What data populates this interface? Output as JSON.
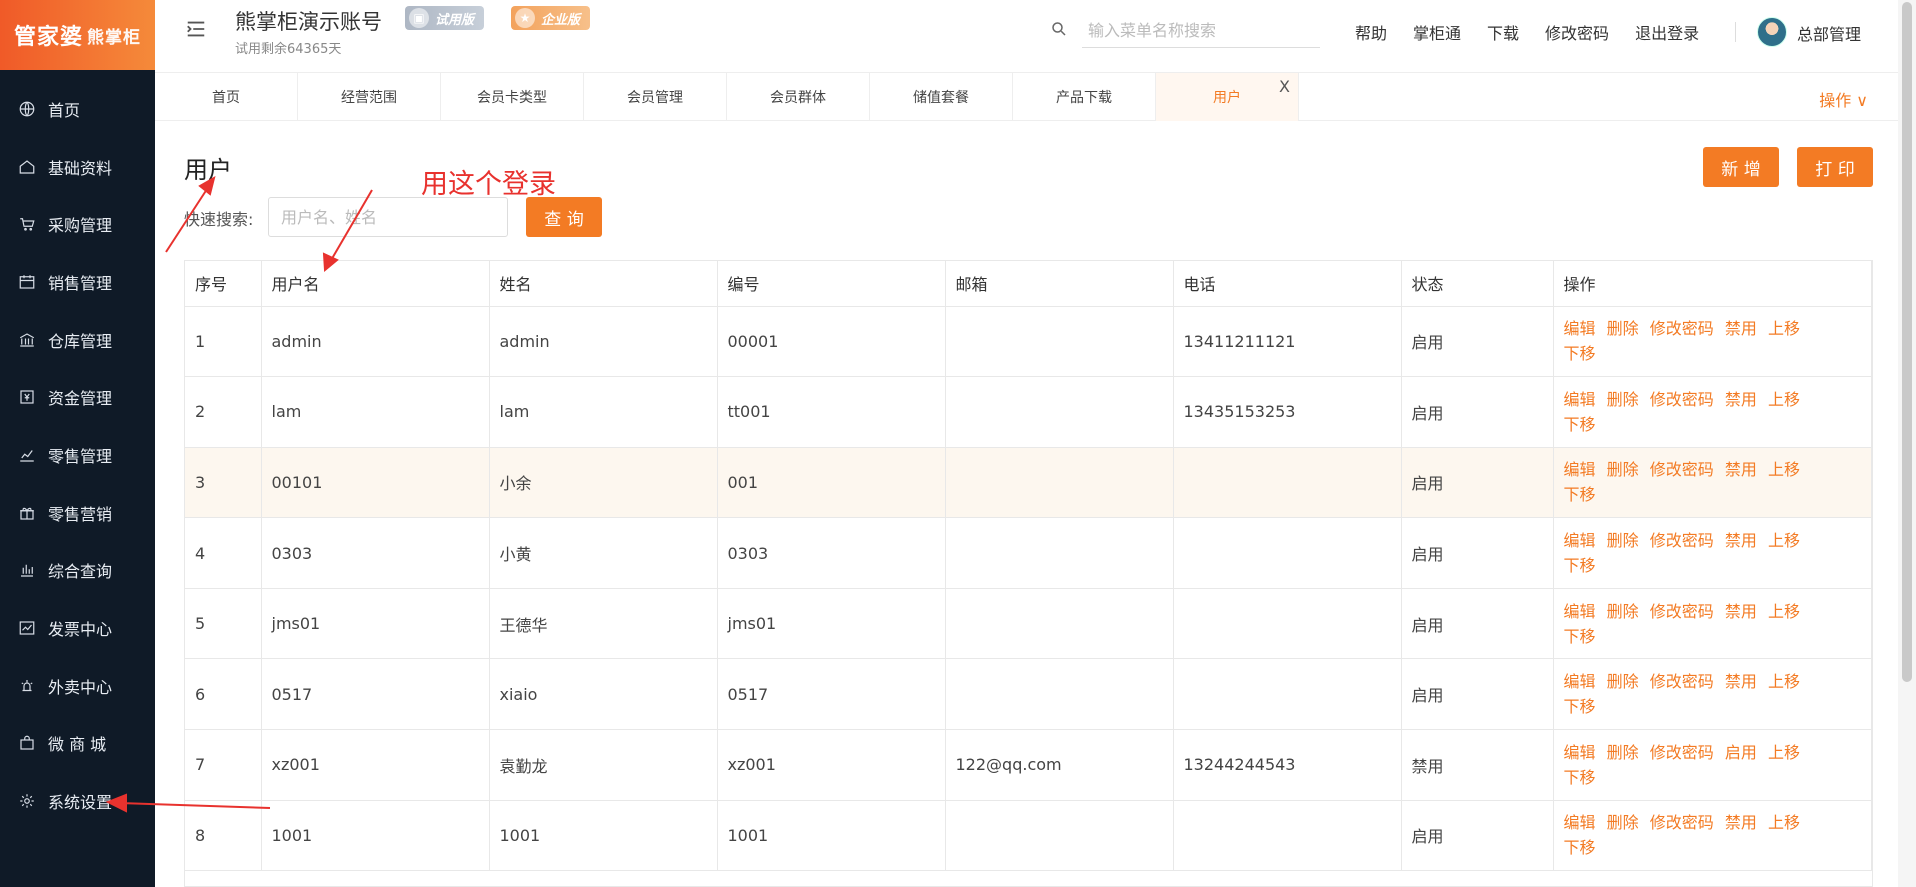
{
  "brand": {
    "logo_main": "管家婆",
    "logo_sub": "熊掌柜"
  },
  "sidebar": {
    "items": [
      {
        "label": "首页",
        "icon": "globe-icon"
      },
      {
        "label": "基础资料",
        "icon": "home-icon"
      },
      {
        "label": "采购管理",
        "icon": "cart-icon"
      },
      {
        "label": "销售管理",
        "icon": "calendar-icon"
      },
      {
        "label": "仓库管理",
        "icon": "bank-icon"
      },
      {
        "label": "资金管理",
        "icon": "yen-icon"
      },
      {
        "label": "零售管理",
        "icon": "chart-icon"
      },
      {
        "label": "零售营销",
        "icon": "gift-icon"
      },
      {
        "label": "综合查询",
        "icon": "bar-icon"
      },
      {
        "label": "发票中心",
        "icon": "trend-icon"
      },
      {
        "label": "外卖中心",
        "icon": "alarm-icon"
      },
      {
        "label": "微 商 城",
        "icon": "bag-icon"
      },
      {
        "label": "系统设置",
        "icon": "gear-icon"
      }
    ]
  },
  "header": {
    "account_title": "熊掌柜演示账号",
    "badge_trial": "试用版",
    "badge_enterprise": "企业版",
    "trial_left": "试用剩余64365天",
    "search_placeholder": "输入菜单名称搜索",
    "links": [
      "帮助",
      "掌柜通",
      "下载",
      "修改密码",
      "退出登录"
    ],
    "user_name": "总部管理"
  },
  "tabs": {
    "items": [
      "首页",
      "经营范围",
      "会员卡类型",
      "会员管理",
      "会员群体",
      "储值套餐",
      "产品下载",
      "用户"
    ],
    "active_index": 7,
    "close_label": "X",
    "ops_label": "操作 ∨"
  },
  "page": {
    "title": "用户",
    "annotation": "用这个登录",
    "add_label": "新 增",
    "print_label": "打 印",
    "quick_search_label": "快速搜索:",
    "quick_search_placeholder": "用户名、姓名",
    "query_label": "查 询"
  },
  "table": {
    "columns": [
      "序号",
      "用户名",
      "姓名",
      "编号",
      "邮箱",
      "电话",
      "状态",
      "操作"
    ],
    "rows": [
      {
        "no": "1",
        "username": "admin",
        "name": "admin",
        "code": "00001",
        "email": "",
        "phone": "13411211121",
        "status": "启用",
        "toggle": "禁用"
      },
      {
        "no": "2",
        "username": "lam",
        "name": "lam",
        "code": "tt001",
        "email": "",
        "phone": "13435153253",
        "status": "启用",
        "toggle": "禁用"
      },
      {
        "no": "3",
        "username": "00101",
        "name": "小余",
        "code": "001",
        "email": "",
        "phone": "",
        "status": "启用",
        "toggle": "禁用"
      },
      {
        "no": "4",
        "username": "0303",
        "name": "小黄",
        "code": "0303",
        "email": "",
        "phone": "",
        "status": "启用",
        "toggle": "禁用"
      },
      {
        "no": "5",
        "username": "jms01",
        "name": "王德华",
        "code": "jms01",
        "email": "",
        "phone": "",
        "status": "启用",
        "toggle": "禁用"
      },
      {
        "no": "6",
        "username": "0517",
        "name": "xiaio",
        "code": "0517",
        "email": "",
        "phone": "",
        "status": "启用",
        "toggle": "禁用"
      },
      {
        "no": "7",
        "username": "xz001",
        "name": "袁勤龙",
        "code": "xz001",
        "email": "122@qq.com",
        "phone": "13244244543",
        "status": "禁用",
        "toggle": "启用"
      },
      {
        "no": "8",
        "username": "1001",
        "name": "1001",
        "code": "1001",
        "email": "",
        "phone": "",
        "status": "启用",
        "toggle": "禁用"
      }
    ],
    "highlight_row": 2,
    "action_labels": {
      "edit": "编辑",
      "delete": "删除",
      "change_password": "修改密码",
      "move_up": "上移",
      "move_down": "下移"
    }
  },
  "colors": {
    "accent": "#f37b24",
    "sidebar_bg": "#0f1a27",
    "annotation": "#e8322e"
  }
}
